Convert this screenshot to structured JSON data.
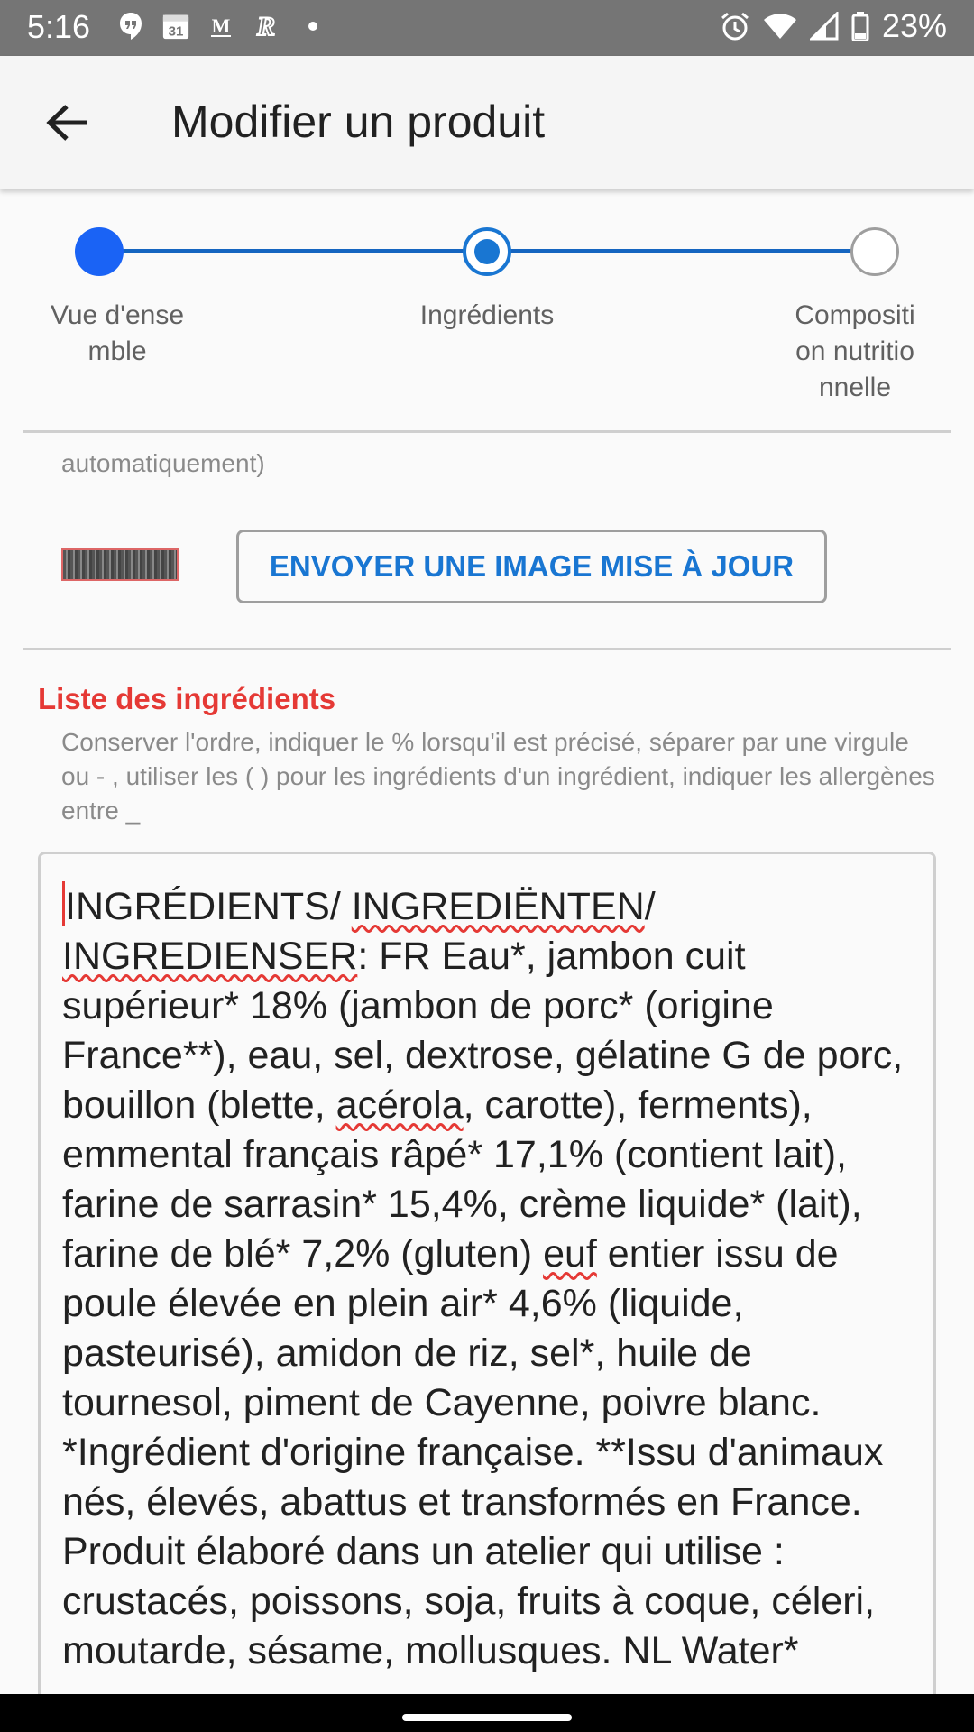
{
  "status_bar": {
    "time": "5:16",
    "left_icons": [
      "hangouts-icon",
      "calendar-icon",
      "gmail-icon",
      "r-app-icon"
    ],
    "calendar_day": "31",
    "battery": "23%"
  },
  "app_bar": {
    "title": "Modifier un produit"
  },
  "stepper": {
    "steps": [
      {
        "label": "Vue d'ense\nmble",
        "state": "done"
      },
      {
        "label": "Ingrédients",
        "state": "current"
      },
      {
        "label": "Compositi\non nutritio\nnnelle",
        "state": "todo"
      }
    ]
  },
  "photo": {
    "caption": "automatiquement)",
    "upload_label": "ENVOYER UNE IMAGE MISE À JOUR"
  },
  "ingredients": {
    "title": "Liste des ingrédients",
    "hint": "Conserver l'ordre, indiquer le % lorsqu'il est précisé, séparer par une virgule ou - , utiliser les ( ) pour les ingrédients d'un ingrédient, indiquer les allergènes entre _",
    "text_parts": [
      "INGRÉDIENTS/ ",
      "INGREDIËNTEN",
      "/ ",
      "INGREDIENSER",
      ": FR Eau*, jambon cuit supérieur* 18% (jambon de porc* (origine France**), eau, sel, dextrose, gélatine G de porc, bouillon (blette, ",
      "acérola",
      ", carotte), ferments), emmental français râpé* 17,1% (contient lait), farine de sarrasin* 15,4%, crème liquide* (lait), farine de blé* 7,2% (gluten) ",
      "euf",
      " entier issu de poule élevée en plein air* 4,6% (liquide, pasteurisé), amidon de riz, sel*, huile de tournesol, piment de Cayenne, poivre blanc. *Ingrédient d'origine française. **Issu d'animaux nés, élevés, abattus et transformés en France. Produit élaboré dans un atelier qui utilise : crustacés, poissons, soja, fruits à coque, céleri, moutarde, sésame, mollusques. NL Water*"
    ]
  },
  "colors": {
    "accent": "#1976d2",
    "required_label": "#e53935",
    "status_bar": "#757575"
  }
}
